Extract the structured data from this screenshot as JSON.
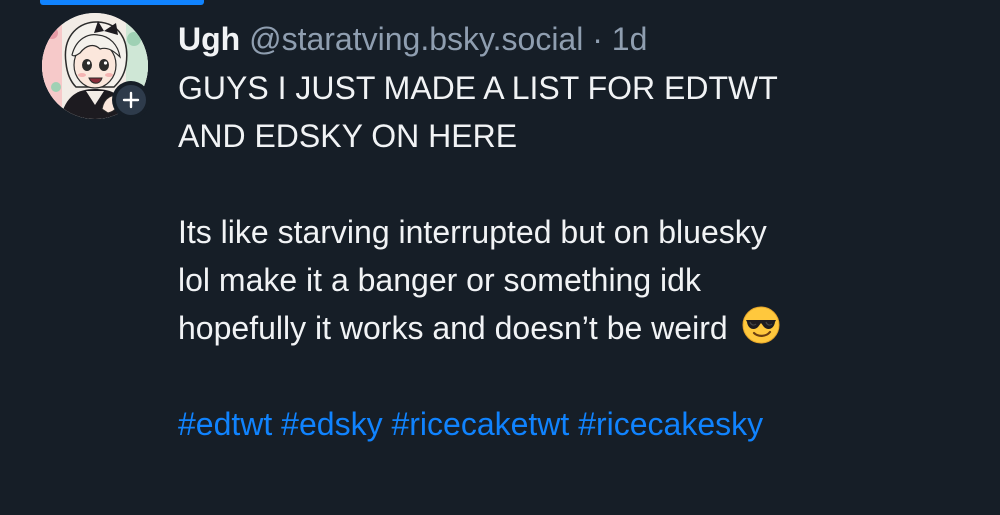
{
  "post": {
    "author": {
      "display_name": "Ugh",
      "handle": "@staratving.bsky.social",
      "separator": "·",
      "timestamp": "1d"
    },
    "follow_badge_icon": "plus-icon",
    "text_lines_block1": [
      "GUYS I JUST MADE A LIST FOR EDTWT",
      "AND EDSKY ON HERE"
    ],
    "text_lines_block2": [
      "Its like starving interrupted but on bluesky",
      "lol make it a banger or something idk",
      "hopefully it works and doesn’t be weird"
    ],
    "emoji": "smiling-face-with-sunglasses",
    "hashtags": [
      "#edtwt",
      "#edsky",
      "#ricecaketwt",
      "#ricecakesky"
    ]
  },
  "colors": {
    "background": "#161e27",
    "text": "#f1f3f5",
    "muted": "#8f9eb0",
    "link": "#1083fe"
  }
}
